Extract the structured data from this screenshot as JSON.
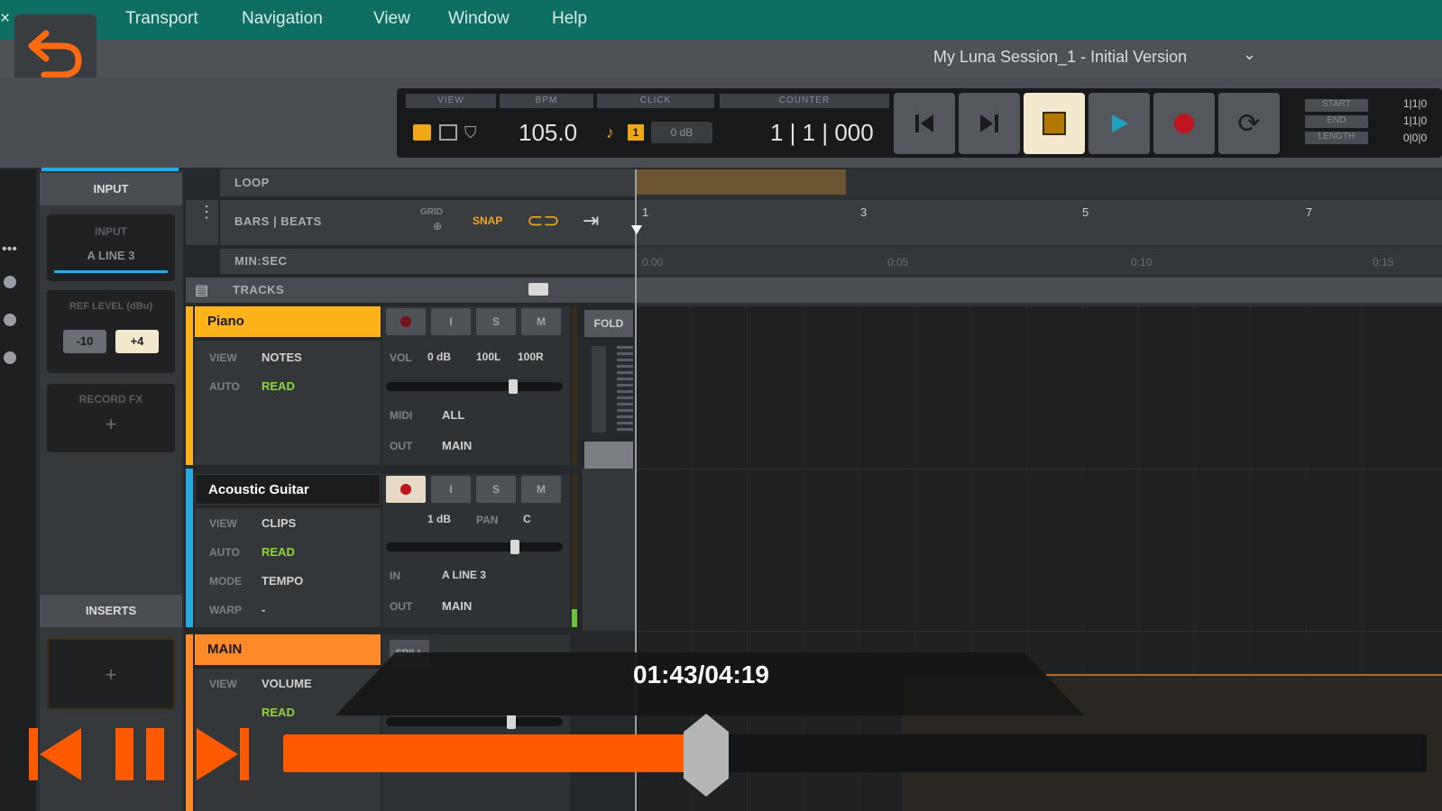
{
  "menu": {
    "items": [
      "Transport",
      "Navigation",
      "View",
      "Window",
      "Help"
    ]
  },
  "session": {
    "title": "My Luna Session_1 - Initial Version"
  },
  "transport": {
    "headers": {
      "view": "VIEW",
      "bpm": "BPM",
      "click": "CLICK",
      "counter": "COUNTER"
    },
    "bpm": "105.0",
    "click_level": "0 dB",
    "click_badge": "1",
    "counter": "1 | 1 | 000",
    "range_labels": [
      "START",
      "END",
      "LENGTH"
    ],
    "range_values": [
      "1|1|0",
      "1|1|0",
      "0|0|0"
    ]
  },
  "input_panel": {
    "header": "INPUT",
    "input_label": "INPUT",
    "input_value": "A LINE 3",
    "ref_level": "REF LEVEL (dBu)",
    "ref_options": [
      "-10",
      "+4"
    ],
    "record_fx": "RECORD FX",
    "plus": "+",
    "inserts_header": "INSERTS"
  },
  "timeline": {
    "loop": "LOOP",
    "bars_beats": "BARS | BEATS",
    "grid": "GRID",
    "snap": "SNAP",
    "min_sec": "MIN:SEC",
    "tracks": "TRACKS",
    "fold": "FOLD",
    "bar_numbers": [
      "1",
      "3",
      "5",
      "7"
    ],
    "time_marks": [
      "0:00",
      "0:05",
      "0:10",
      "0:15"
    ]
  },
  "tracks": [
    {
      "name": "Piano",
      "color": "#ffb31a",
      "view_label": "VIEW",
      "view": "NOTES",
      "auto_label": "AUTO",
      "auto": "READ",
      "vol_label": "VOL",
      "vol": "0 dB",
      "pan_l": "100L",
      "pan_r": "100R",
      "midi_label": "MIDI",
      "midi": "ALL",
      "out_label": "OUT",
      "out": "MAIN",
      "buttons": [
        "I",
        "S",
        "M"
      ]
    },
    {
      "name": "Acoustic Guitar",
      "color": "#2aa8e0",
      "view_label": "VIEW",
      "view": "CLIPS",
      "auto_label": "AUTO",
      "auto": "READ",
      "mode_label": "MODE",
      "mode": "TEMPO",
      "warp_label": "WARP",
      "warp": "-",
      "vol": "1 dB",
      "pan_label": "PAN",
      "pan": "C",
      "in_label": "IN",
      "in": "A LINE 3",
      "out_label": "OUT",
      "out": "MAIN",
      "buttons": [
        "I",
        "S",
        "M"
      ]
    },
    {
      "name": "MAIN",
      "color": "#ff8a2a",
      "view_label": "VIEW",
      "view": "VOLUME",
      "auto": "READ",
      "spill": "SPILL"
    }
  ],
  "player": {
    "time": "01:43/04:19",
    "progress": 0.37
  }
}
